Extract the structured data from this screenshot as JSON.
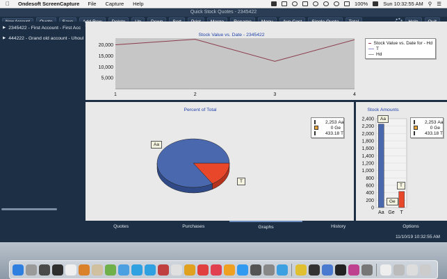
{
  "menubar": {
    "app_name": "Ondesoft ScreenCapture",
    "menus": [
      "File",
      "Capture",
      "Help"
    ],
    "battery": "100%",
    "clock": "Sun 10:32:55 AM"
  },
  "window": {
    "title": "Quick Stock Quotes - 2345422"
  },
  "toolbar": {
    "buttons": [
      "New Account",
      "Quote",
      "Save",
      "Add Row",
      "Delete",
      "Up",
      "Down",
      "Sort",
      "Print",
      "Merge",
      "Rename",
      "Menu",
      "Ave Cost",
      "Single Quote",
      "Total"
    ],
    "help_label": "Help",
    "quit_label": "Quit"
  },
  "accounts": [
    {
      "label": "2345422 - First Account - First Acc"
    },
    {
      "label": "444222 - Grand old account - Uhoul"
    }
  ],
  "line_chart": {
    "title": "Stock Value vs. Date - 2345422",
    "legend": [
      "Stock Value vs. Date for - Hd",
      "T",
      "Hd"
    ],
    "colors": {
      "value": "#8b3a4a",
      "T": "#8a8fd0",
      "Hd": "#9a9a9a"
    }
  },
  "pie_chart": {
    "title": "Percent of Total",
    "label_aa": "Aa",
    "label_t": "T",
    "legend": [
      {
        "value": "2,253",
        "name": "Aa",
        "color": "#4a68ad"
      },
      {
        "value": "0",
        "name": "Ge",
        "color": "#e8a33a"
      },
      {
        "value": "433.18",
        "name": "T",
        "color": "#e8472a"
      }
    ]
  },
  "bar_chart": {
    "title": "Stock Amounts",
    "tag_aa": "Aa",
    "tag_ge": "Ge",
    "tag_t": "T",
    "legend": [
      {
        "value": "2,253",
        "name": "Aa"
      },
      {
        "value": "0",
        "name": "Ge"
      },
      {
        "value": "433.18",
        "name": "T"
      }
    ]
  },
  "chart_data": [
    {
      "type": "line",
      "title": "Stock Value vs. Date - 2345422",
      "x": [
        1,
        2,
        3,
        4
      ],
      "yticks": [
        "5,000",
        "10,000",
        "15,000",
        "20,000"
      ],
      "xticks": [
        "1",
        "2",
        "3",
        "4"
      ],
      "ylim": [
        0,
        23000
      ],
      "series": [
        {
          "name": "Stock Value vs. Date for - Hd",
          "values": [
            20000,
            22500,
            12500,
            22300
          ]
        },
        {
          "name": "T",
          "values": [
            0,
            0,
            0,
            0
          ]
        },
        {
          "name": "Hd",
          "values": [
            0,
            0,
            0,
            0
          ]
        }
      ],
      "grid": false,
      "legend_position": "top-right"
    },
    {
      "type": "pie",
      "title": "Percent of Total",
      "categories": [
        "Aa",
        "Ge",
        "T"
      ],
      "values": [
        2253,
        0,
        433.18
      ]
    },
    {
      "type": "bar",
      "title": "Stock Amounts",
      "categories": [
        "Aa",
        "Ge",
        "T"
      ],
      "values": [
        2253,
        0,
        433.18
      ],
      "yticks": [
        "0",
        "200",
        "400",
        "600",
        "800",
        "1,000",
        "1,200",
        "1,400",
        "1,600",
        "1,800",
        "2,000",
        "2,200",
        "2,400"
      ],
      "ylim": [
        0,
        2400
      ],
      "grid": true
    }
  ],
  "tabs": [
    "Quotes",
    "Purchases",
    "Graphs",
    "History",
    "Options"
  ],
  "active_tab": "Graphs",
  "status": {
    "datetime": "11/10/19 10:32:55 AM"
  }
}
